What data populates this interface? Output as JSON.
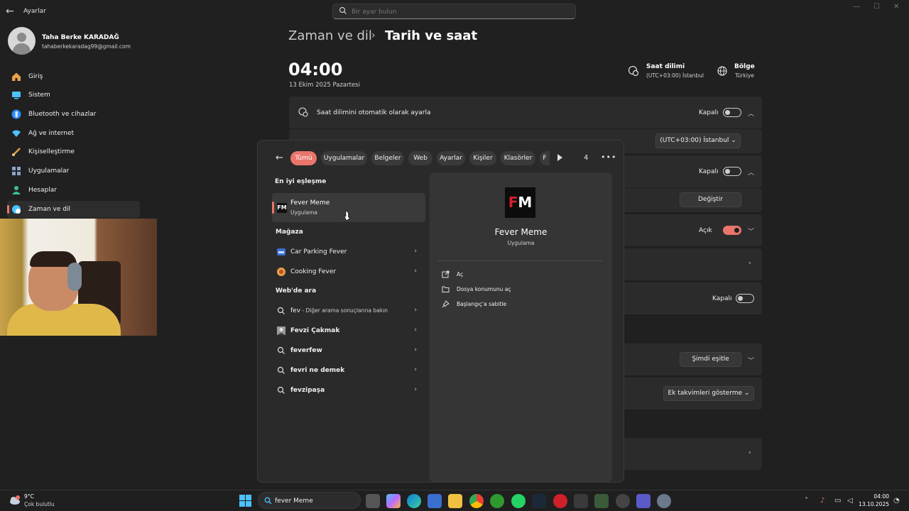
{
  "window": {
    "title": "Ayarlar",
    "search_placeholder": "Bir ayar bulun"
  },
  "user": {
    "name": "Taha Berke KARADAĞ",
    "email": "tahaberkekaradag99@gmail.com"
  },
  "sidebar": {
    "items": [
      {
        "label": "Giriş",
        "icon": "home-icon",
        "color": "#e8a04a"
      },
      {
        "label": "Sistem",
        "icon": "monitor-icon",
        "color": "#4cc2ff"
      },
      {
        "label": "Bluetooth ve cihazlar",
        "icon": "bluetooth-icon",
        "color": "#2d8cff"
      },
      {
        "label": "Ağ ve internet",
        "icon": "wifi-icon",
        "color": "#4cc2ff"
      },
      {
        "label": "Kişiselleştirme",
        "icon": "brush-icon",
        "color": "#e8a04a"
      },
      {
        "label": "Uygulamalar",
        "icon": "apps-icon",
        "color": "#8aa4c8"
      },
      {
        "label": "Hesaplar",
        "icon": "person-icon",
        "color": "#3ac28a"
      },
      {
        "label": "Zaman ve dil",
        "icon": "globe-clock-icon",
        "color": "#4cc2ff",
        "active": true
      }
    ]
  },
  "header": {
    "breadcrumb_parent": "Zaman ve dil",
    "breadcrumb_sep": "›",
    "page_title": "Tarih ve saat"
  },
  "clock": {
    "time": "04:00",
    "date": "13 Ekim 2025 Pazartesi"
  },
  "timezone": {
    "title": "Saat dilimi",
    "value": "(UTC+03:00) İstanbul"
  },
  "region": {
    "title": "Bölge",
    "value": "Türkiye"
  },
  "settings": {
    "auto_tz_label": "Saat dilimini otomatik olarak ayarla",
    "auto_tz_state": "Kapalı",
    "tz_select": "(UTC+03:00) İstanbul",
    "row2_state": "Kapalı",
    "change_button": "Değiştir",
    "row3_state": "Açık",
    "row5_state": "Kapalı",
    "sync_button": "Şimdi eşitle",
    "calendar_select": "Ek takvimleri gösterme"
  },
  "start_menu": {
    "filters": [
      "Tümü",
      "Uygulamalar",
      "Belgeler",
      "Web",
      "Ayarlar",
      "Kişiler",
      "Klasörler",
      "F"
    ],
    "count": "4",
    "best_match_title": "En iyi eşleşme",
    "best_match": {
      "name": "Fever Meme",
      "type": "Uygulama",
      "logo": "FM"
    },
    "store_title": "Mağaza",
    "store_items": [
      {
        "label": "Car Parking Fever",
        "icon": "car-icon"
      },
      {
        "label": "Cooking Fever",
        "icon": "food-icon"
      }
    ],
    "web_title": "Web'de ara",
    "web_items": [
      {
        "label": "fev",
        "sub": " - Diğer arama sonuçlarına bakın",
        "icon": "search-icon"
      },
      {
        "label": "Fevzi Çakmak",
        "sub": "",
        "icon": "portrait-icon"
      },
      {
        "label": "feverfew",
        "sub": "",
        "icon": "search-icon"
      },
      {
        "label": "fevri ne demek",
        "sub": "",
        "icon": "search-icon"
      },
      {
        "label": "fevzipaşa",
        "sub": "",
        "icon": "search-icon"
      }
    ],
    "detail": {
      "name": "Fever Meme",
      "type": "Uygulama",
      "actions": [
        {
          "label": "Aç",
          "icon": "open-icon"
        },
        {
          "label": "Dosya konumunu aç",
          "icon": "folder-icon"
        },
        {
          "label": "Başlangıç'a sabitle",
          "icon": "pin-icon"
        }
      ]
    }
  },
  "taskbar": {
    "weather_temp": "9°C",
    "weather_desc": "Çok bulutlu",
    "search_text": "fever Meme",
    "time": "04:00",
    "date": "13.10.2025",
    "accent": "#e9756b"
  }
}
